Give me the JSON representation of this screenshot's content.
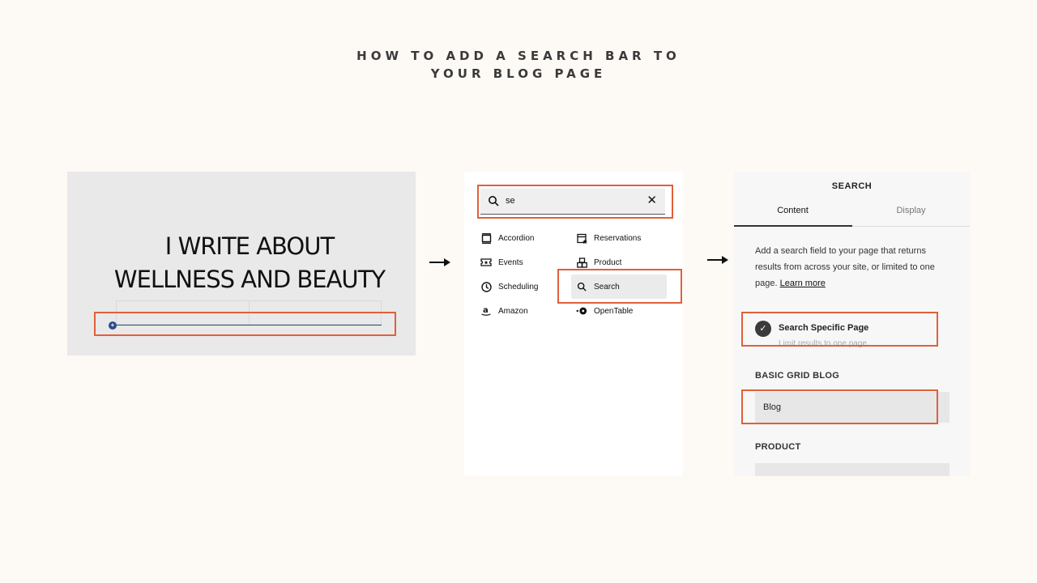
{
  "page": {
    "title_line1": "HOW TO ADD A SEARCH BAR TO",
    "title_line2": "YOUR BLOG PAGE"
  },
  "editor_preview": {
    "heading_line1": "I WRITE ABOUT",
    "heading_line2": "WELLNESS AND BEAUTY",
    "insert_point_symbol": "+"
  },
  "block_picker": {
    "search_value": "se",
    "clear_symbol": "✕",
    "items": [
      {
        "label": "Accordion",
        "icon": "accordion-icon"
      },
      {
        "label": "Reservations",
        "icon": "reservations-icon"
      },
      {
        "label": "Events",
        "icon": "events-icon"
      },
      {
        "label": "Product",
        "icon": "product-icon"
      },
      {
        "label": "Scheduling",
        "icon": "clock-icon"
      },
      {
        "label": "Search",
        "icon": "search-icon"
      },
      {
        "label": "Amazon",
        "icon": "amazon-icon"
      },
      {
        "label": "OpenTable",
        "icon": "opentable-icon"
      }
    ],
    "selected": "Search"
  },
  "settings": {
    "title": "SEARCH",
    "tabs": [
      {
        "label": "Content",
        "active": true
      },
      {
        "label": "Display",
        "active": false
      }
    ],
    "description": "Add a search field to your page that returns results from across your site, or limited to one page.",
    "learn_more": "Learn more",
    "toggle_label": "Search Specific Page",
    "toggle_sub": "Limit results to one page.",
    "check_symbol": "✓",
    "section1_label": "BASIC GRID BLOG",
    "section1_value": "Blog",
    "section2_label": "PRODUCT",
    "section2_value": ""
  },
  "colors": {
    "highlight": "#e0603a",
    "background": "#fdf9f5",
    "insert_line": "#2b4a8a"
  }
}
